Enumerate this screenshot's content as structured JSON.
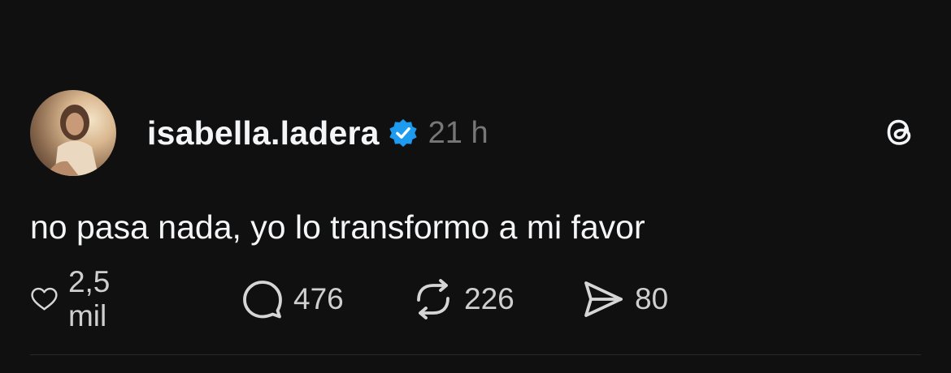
{
  "post": {
    "username": "isabella.ladera",
    "verified_color": "#1d9bf0",
    "time": "21 h",
    "text": "no pasa nada, yo lo transformo a mi favor",
    "actions": {
      "like": {
        "icon": "heart-icon",
        "count": "2,5 mil"
      },
      "reply": {
        "icon": "comment-bubble-icon",
        "count": "476"
      },
      "repost": {
        "icon": "repost-icon",
        "count": "226"
      },
      "share": {
        "icon": "send-icon",
        "count": "80"
      }
    }
  },
  "app": {
    "logo": "threads-logo-icon"
  }
}
